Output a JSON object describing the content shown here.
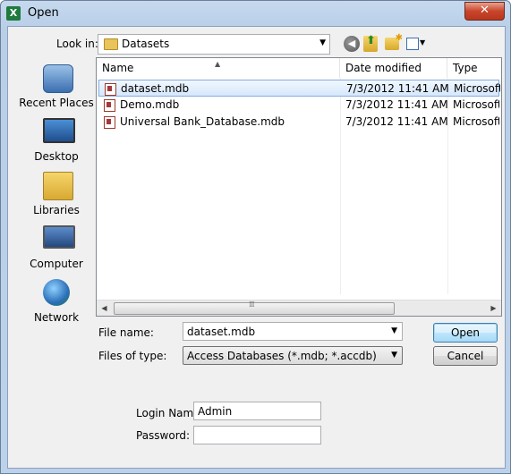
{
  "window": {
    "title": "Open",
    "app_icon": "excel-icon",
    "close_label": "✕"
  },
  "toolbar": {
    "look_in_label": "Look in:",
    "look_in_value": "Datasets",
    "icons": [
      "back-icon",
      "up-folder-icon",
      "new-folder-icon",
      "views-menu-icon"
    ]
  },
  "places": [
    {
      "label": "Recent Places",
      "icon": "recent-places-icon"
    },
    {
      "label": "Desktop",
      "icon": "desktop-icon"
    },
    {
      "label": "Libraries",
      "icon": "libraries-icon"
    },
    {
      "label": "Computer",
      "icon": "computer-icon"
    },
    {
      "label": "Network",
      "icon": "network-icon"
    }
  ],
  "file_list": {
    "columns": [
      "Name",
      "Date modified",
      "Type"
    ],
    "rows": [
      {
        "name": "dataset.mdb",
        "date": "7/3/2012 11:41 AM",
        "type": "Microsoft",
        "selected": true
      },
      {
        "name": "Demo.mdb",
        "date": "7/3/2012 11:41 AM",
        "type": "Microsoft",
        "selected": false
      },
      {
        "name": "Universal Bank_Database.mdb",
        "date": "7/3/2012 11:41 AM",
        "type": "Microsoft",
        "selected": false
      }
    ]
  },
  "form": {
    "file_name_label": "File name:",
    "file_name_value": "dataset.mdb",
    "files_of_type_label": "Files of type:",
    "files_of_type_value": "Access Databases (*.mdb; *.accdb)",
    "open_label": "Open",
    "cancel_label": "Cancel",
    "login_name_label": "Login Name:",
    "login_name_value": "Admin",
    "password_label": "Password:",
    "password_value": ""
  }
}
